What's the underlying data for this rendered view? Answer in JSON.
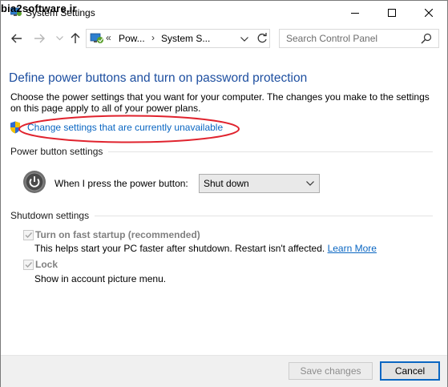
{
  "watermark": "bia2software.ir",
  "window": {
    "title": "System Settings",
    "controls": [
      "minimize-icon",
      "maximize-icon",
      "close-icon"
    ]
  },
  "navigation": {
    "back_icon": "arrow-left-icon",
    "forward_icon": "arrow-right-icon",
    "recent_icon": "chevron-down-icon",
    "up_icon": "arrow-up-icon",
    "breadcrumb_overflow": "«",
    "breadcrumbs": [
      "Pow...",
      "System S..."
    ],
    "breadcrumb_separator": "›",
    "refresh_icon": "refresh-icon",
    "search_placeholder": "Search Control Panel"
  },
  "main": {
    "heading": "Define power buttons and turn on password protection",
    "description": "Choose the power settings that you want for your computer. The changes you make to the settings on this page apply to all of your power plans.",
    "change_settings_link": "Change settings that are currently unavailable",
    "power_section": {
      "label": "Power button settings",
      "power_label": "When I press the power button:",
      "power_action": "Shut down"
    },
    "shutdown_section": {
      "label": "Shutdown settings",
      "options": [
        {
          "title": "Turn on fast startup (recommended)",
          "checked": true,
          "enabled": false,
          "description": "This helps start your PC faster after shutdown. Restart isn't affected.",
          "link": "Learn More"
        },
        {
          "title": "Lock",
          "checked": true,
          "enabled": false,
          "description": "Show in account picture menu."
        }
      ]
    }
  },
  "footer": {
    "save_label": "Save changes",
    "cancel_label": "Cancel"
  },
  "colors": {
    "link": "#0a66c2",
    "heading": "#1e4fa0",
    "annotation": "#e0232e"
  }
}
